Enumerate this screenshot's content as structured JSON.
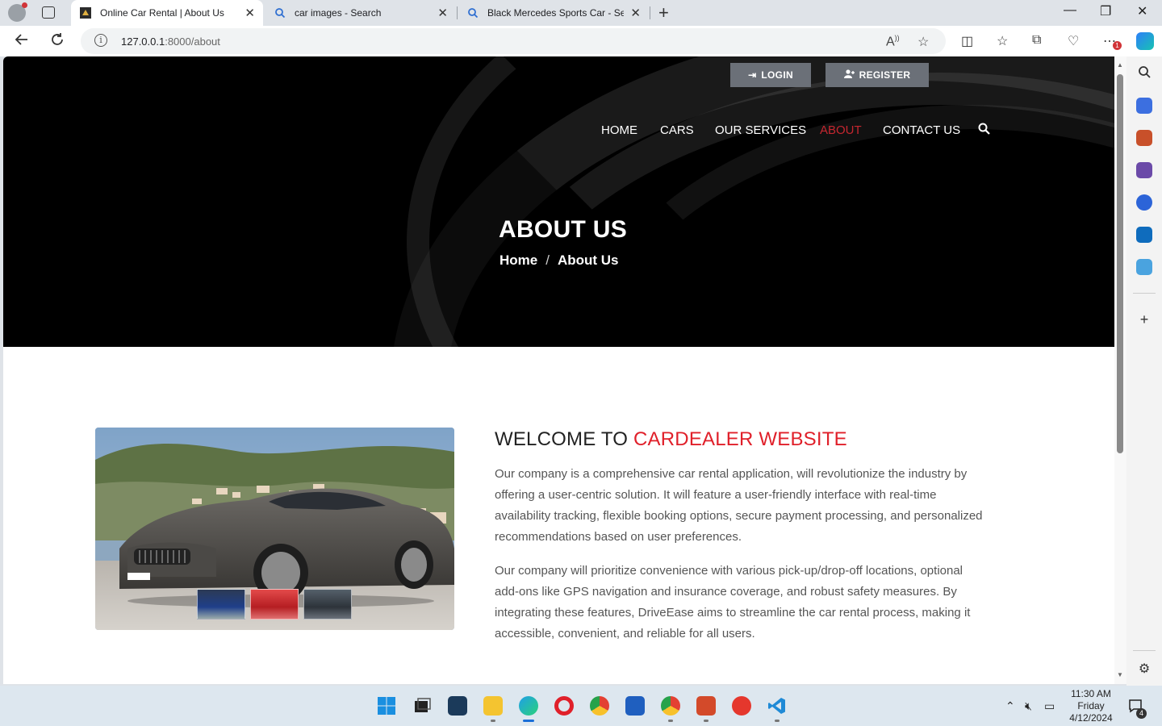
{
  "browser": {
    "tabs": [
      {
        "title": "Online Car Rental | About Us",
        "active": true
      },
      {
        "title": "car images - Search",
        "active": false
      },
      {
        "title": "Black Mercedes Sports Car - Sear",
        "active": false
      }
    ],
    "url_host": "127.0.0.1",
    "url_rest": ":8000/about"
  },
  "header": {
    "login_label": "LOGIN",
    "register_label": "REGISTER",
    "nav": [
      "HOME",
      "CARS",
      "OUR SERVICES",
      "ABOUT",
      "CONTACT US"
    ],
    "active_nav": "ABOUT"
  },
  "hero": {
    "title": "ABOUT US",
    "breadcrumb_home": "Home",
    "breadcrumb_sep": "/",
    "breadcrumb_current": "About Us"
  },
  "about": {
    "heading_prefix": "WELCOME TO ",
    "heading_accent": "CARDEALER WEBSITE",
    "paragraph1": "Our company is a comprehensive car rental application, will revolutionize the industry by offering a user-centric solution. It will feature a user-friendly interface with real-time availability tracking, flexible booking options, secure payment processing, and personalized recommendations based on user preferences.",
    "paragraph2": "Our company will prioritize convenience with various pick-up/drop-off locations, optional add-ons like GPS navigation and insurance coverage, and robust safety measures. By integrating these features, DriveEase aims to streamline the car rental process, making it accessible, convenient, and reliable for all users."
  },
  "taskbar": {
    "time": "11:30 AM",
    "day": "Friday",
    "date": "4/12/2024",
    "notification_count": "4"
  },
  "colors": {
    "accent_red": "#e0202a",
    "nav_active": "#c5262f",
    "button_gray": "#6b7078"
  }
}
